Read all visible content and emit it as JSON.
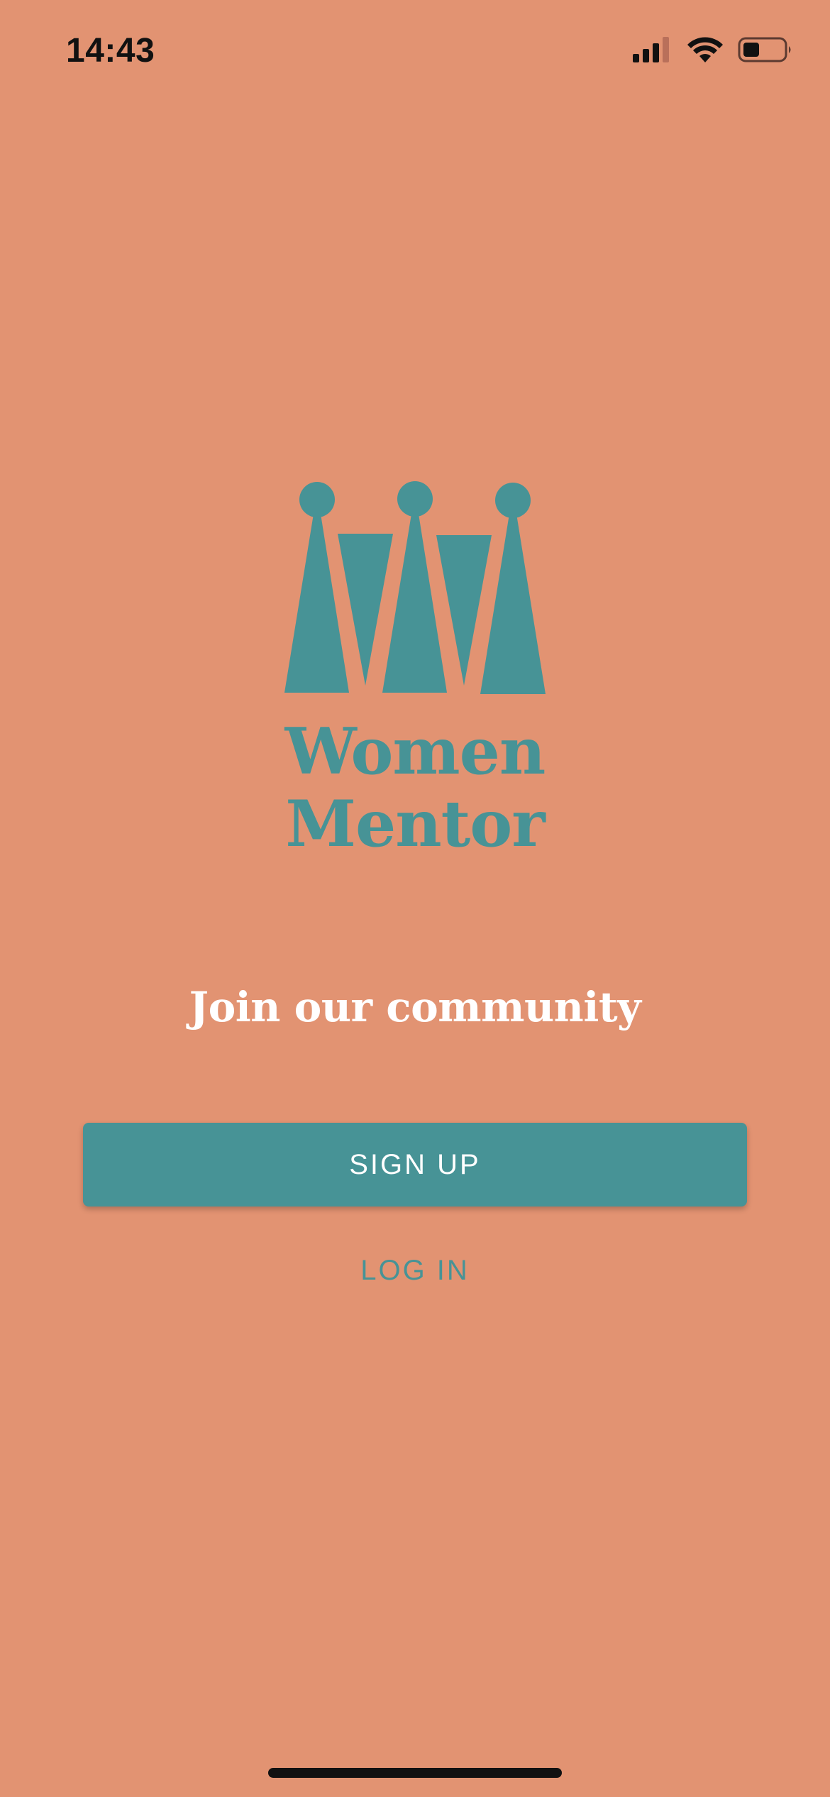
{
  "status_bar": {
    "time": "14:43",
    "icons": [
      "cellular-signal-icon",
      "wifi-icon",
      "battery-icon"
    ],
    "battery_level": 0.4
  },
  "brand": {
    "line1": "Women",
    "line2": "Mentor",
    "logo_icon": "crown-logo-icon",
    "color": "#479396"
  },
  "tagline": "Join our community",
  "actions": {
    "signup_label": "SIGN UP",
    "login_label": "LOG IN"
  },
  "colors": {
    "background": "#E29372",
    "accent": "#479396",
    "text_light": "#FFFFFF"
  }
}
